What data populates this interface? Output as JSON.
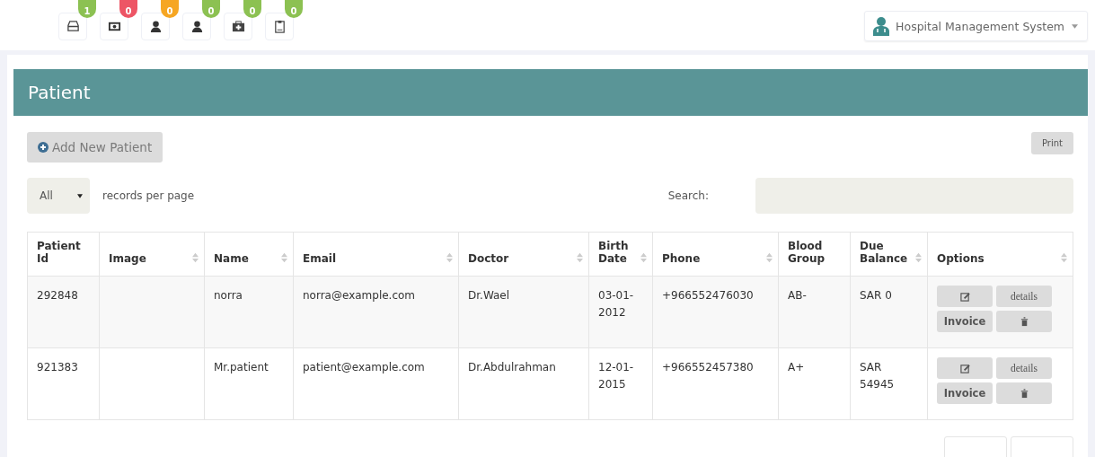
{
  "toolbar": [
    {
      "kind": "drawer",
      "count": "1",
      "color": "#8cc152"
    },
    {
      "kind": "money",
      "count": "0",
      "color": "#ed5565"
    },
    {
      "kind": "person",
      "count": "0",
      "color": "#f6a623"
    },
    {
      "kind": "person",
      "count": "0",
      "color": "#8cc152"
    },
    {
      "kind": "medkit",
      "count": "0",
      "color": "#8cc152"
    },
    {
      "kind": "clipboard",
      "count": "0",
      "color": "#8cc152"
    }
  ],
  "user_menu": {
    "label": "Hospital Management System"
  },
  "panel": {
    "title": "Patient"
  },
  "add_button": {
    "label": "Add New Patient"
  },
  "print_button": {
    "label": "Print"
  },
  "page_length": {
    "value": "All",
    "caption": "records per page"
  },
  "search": {
    "label": "Search:"
  },
  "table": {
    "columns": [
      {
        "label": "Patient Id",
        "sortable": false
      },
      {
        "label": "Image",
        "sortable": true
      },
      {
        "label": "Name",
        "sortable": true
      },
      {
        "label": "Email",
        "sortable": true
      },
      {
        "label": "Doctor",
        "sortable": true
      },
      {
        "label": "Birth Date",
        "sortable": true
      },
      {
        "label": "Phone",
        "sortable": true
      },
      {
        "label": "Blood Group",
        "sortable": false
      },
      {
        "label": "Due Balance",
        "sortable": true
      },
      {
        "label": "Options",
        "sortable": true
      }
    ],
    "rows": [
      {
        "id": "292848",
        "name": "norra",
        "email": "norra@example.com",
        "doctor": "Dr.Wael",
        "birth_date": "03-01-2012",
        "phone": "+966552476030",
        "blood_group": "AB-",
        "due_balance": "SAR 0",
        "details": "details",
        "invoice": "Invoice"
      },
      {
        "id": "921383",
        "name": "Mr.patient",
        "email": "patient@example.com",
        "doctor": "Dr.Abdulrahman",
        "birth_date": "12-01-2015",
        "phone": "+966552457380",
        "blood_group": "A+",
        "due_balance": "SAR 54945",
        "details": "details",
        "invoice": "Invoice"
      }
    ]
  }
}
